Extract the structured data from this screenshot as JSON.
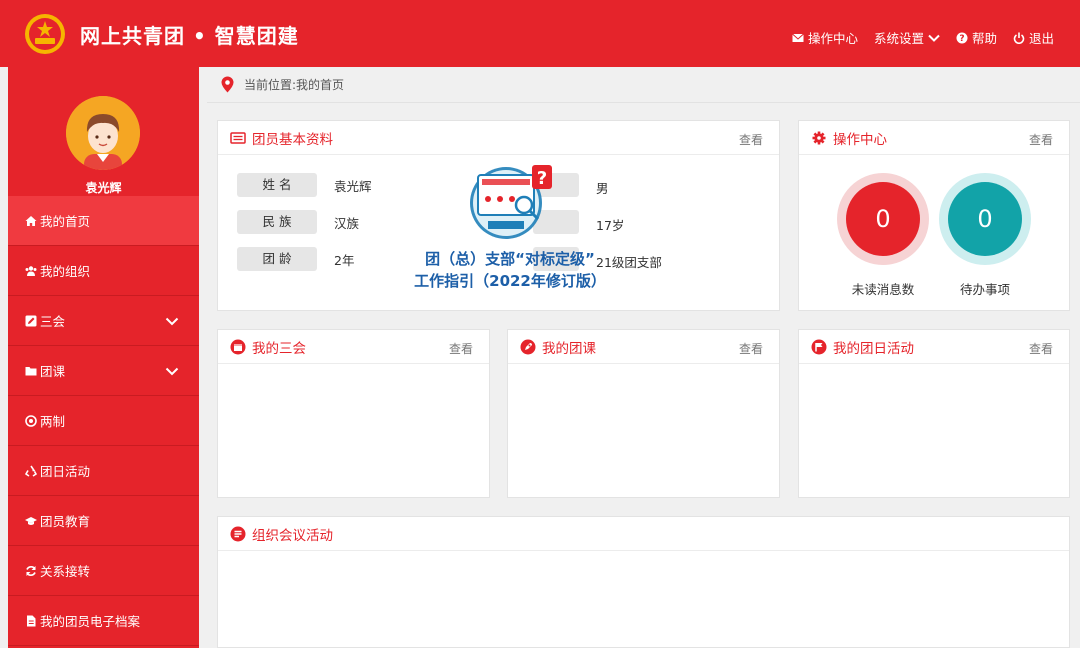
{
  "header": {
    "title": "网上共青团 • 智慧团建",
    "nav": [
      {
        "label": "操作中心",
        "icon": "envelope-icon"
      },
      {
        "label": "系统设置",
        "icon": "chevron-down-icon"
      },
      {
        "label": "帮助",
        "icon": "help-icon"
      },
      {
        "label": "退出",
        "icon": "power-icon"
      }
    ],
    "brand_color": "#e5242b"
  },
  "sidebar": {
    "user_name": "袁光辉",
    "items": [
      {
        "label": "我的首页",
        "icon": "home-icon",
        "active": true
      },
      {
        "label": "我的组织",
        "icon": "users-icon"
      },
      {
        "label": "三会",
        "icon": "edit-icon",
        "expandable": true
      },
      {
        "label": "团课",
        "icon": "folder-icon",
        "expandable": true
      },
      {
        "label": "两制",
        "icon": "target-icon"
      },
      {
        "label": "团日活动",
        "icon": "recycle-icon"
      },
      {
        "label": "团员教育",
        "icon": "graduation-cap-icon"
      },
      {
        "label": "关系接转",
        "icon": "refresh-icon"
      },
      {
        "label": "我的团员电子档案",
        "icon": "file-icon"
      }
    ]
  },
  "breadcrumb": "当前位置:我的首页",
  "profile_panel": {
    "title": "团员基本资料",
    "more": "查看",
    "rows": [
      {
        "label": "姓 名",
        "value": "袁光辉"
      },
      {
        "label": "民 族",
        "value": "汉族"
      },
      {
        "label": "团 龄",
        "value": "2年"
      }
    ],
    "right_values": [
      "男",
      "17岁",
      "21级团支部"
    ]
  },
  "overlay": {
    "line1": "团（总）支部“对标定级”",
    "line2": "工作指引（2022年修订版）"
  },
  "ops_panel": {
    "title": "操作中心",
    "more": "查看",
    "unread": {
      "value": "0",
      "label": "未读消息数",
      "color": "#e5242b"
    },
    "todo": {
      "value": "0",
      "label": "待办事项",
      "color": "#12a3a8"
    }
  },
  "panels": {
    "sanhui": {
      "title": "我的三会",
      "more": "查看"
    },
    "tuanke": {
      "title": "我的团课",
      "more": "查看"
    },
    "tuanri": {
      "title": "我的团日活动",
      "more": "查看"
    },
    "meeting": {
      "title": "组织会议活动"
    }
  }
}
